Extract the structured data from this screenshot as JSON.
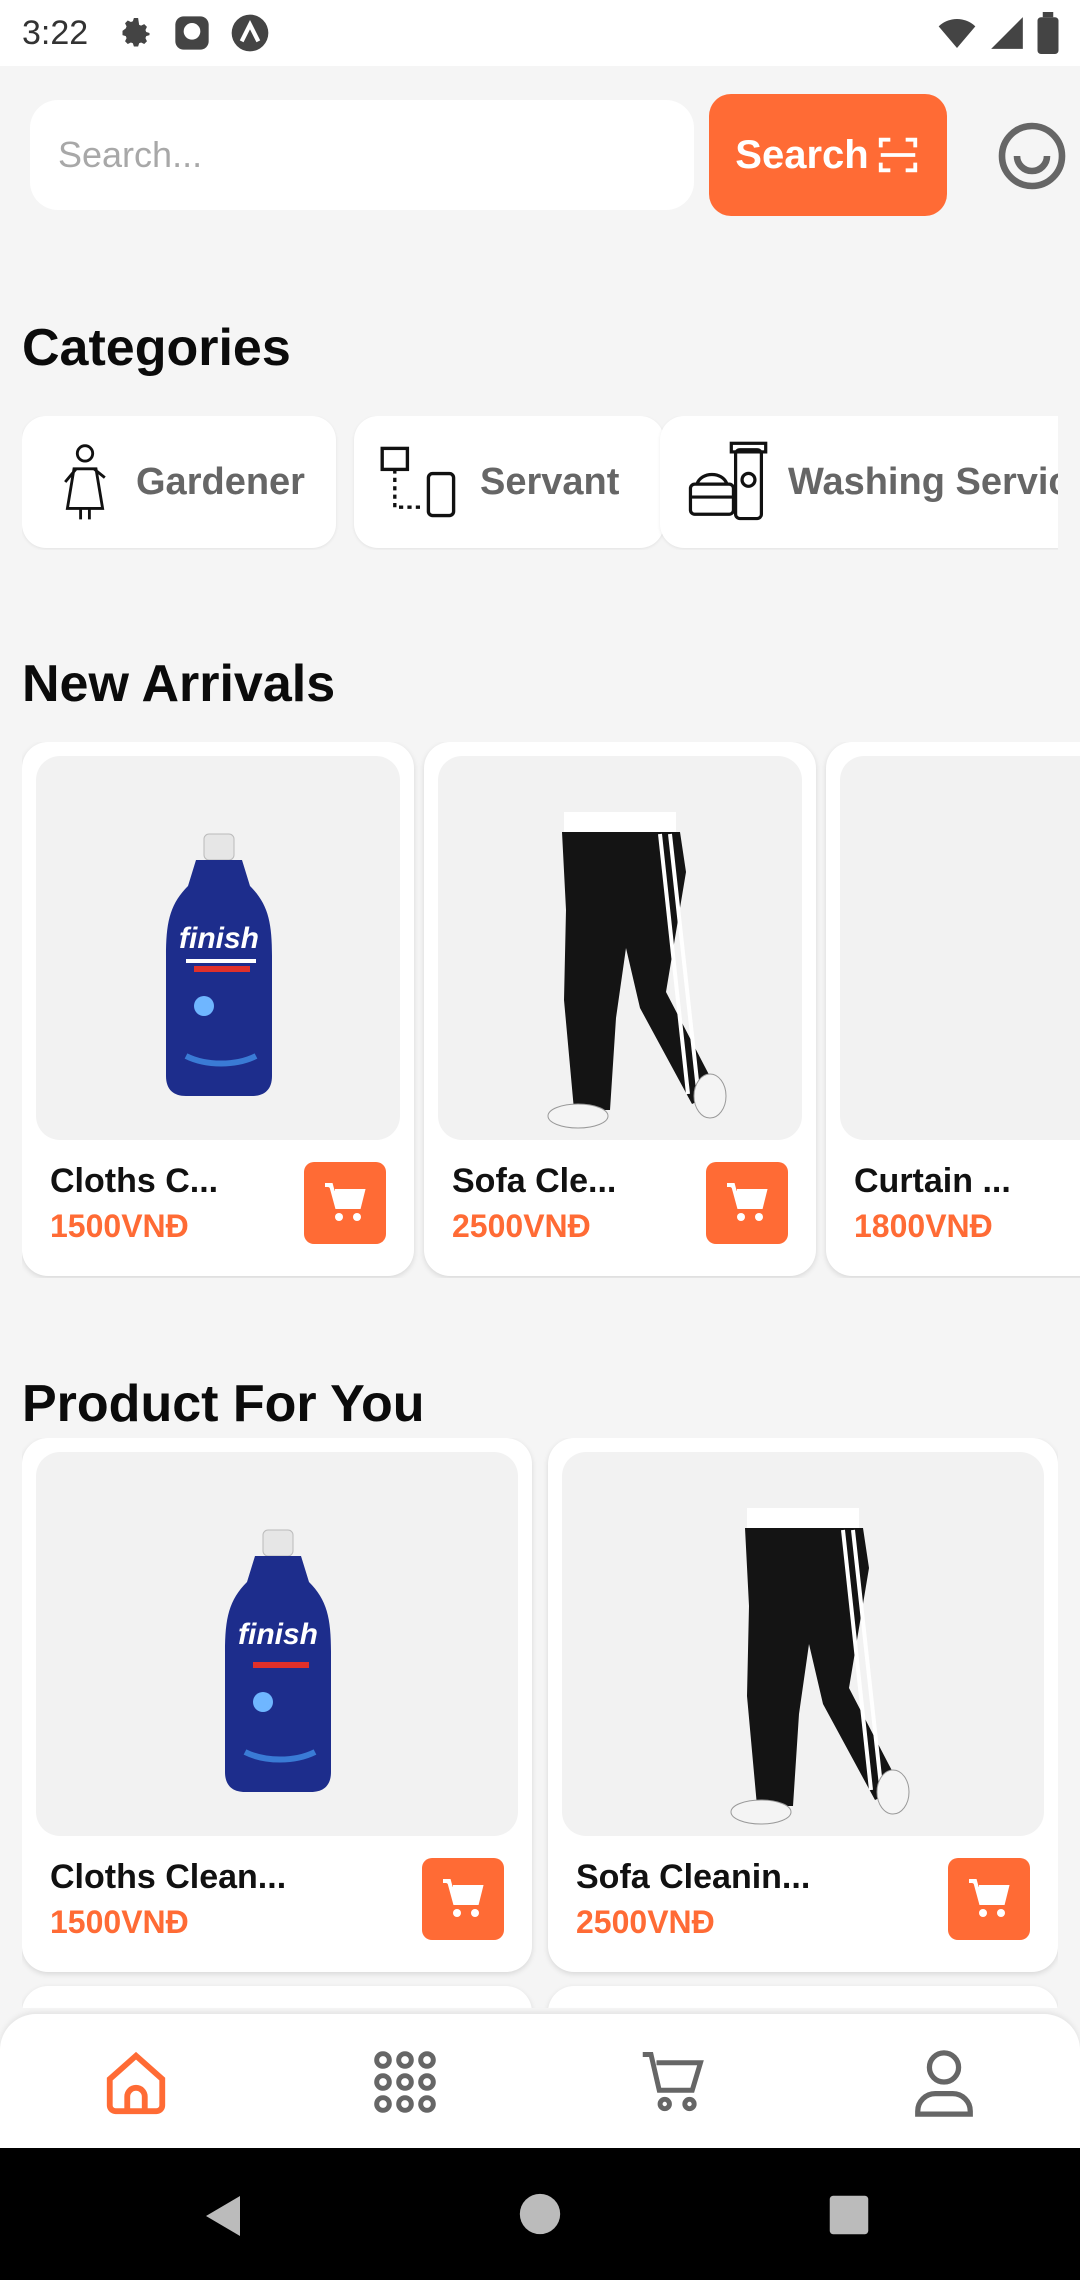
{
  "status": {
    "time": "3:22"
  },
  "search": {
    "placeholder": "Search...",
    "button_label": "Search"
  },
  "sections": {
    "categories": "Categories",
    "new_arrivals": "New Arrivals",
    "for_you": "Product For You"
  },
  "categories": [
    {
      "label": "Gardener",
      "icon": "gardener-icon"
    },
    {
      "label": "Servant",
      "icon": "devices-icon"
    },
    {
      "label": "Washing Servic",
      "icon": "washing-products-icon"
    }
  ],
  "new_arrivals": [
    {
      "name": "Cloths C...",
      "price": "1500VNĐ",
      "image": "rinse-aid-bottle"
    },
    {
      "name": "Sofa Cle...",
      "price": "2500VNĐ",
      "image": "black-track-pants"
    },
    {
      "name": "Curtain ...",
      "price": "1800VNĐ",
      "image": "blank"
    }
  ],
  "for_you": [
    {
      "name": "Cloths Clean...",
      "price": "1500VNĐ",
      "image": "rinse-aid-bottle"
    },
    {
      "name": "Sofa Cleanin...",
      "price": "2500VNĐ",
      "image": "black-track-pants"
    }
  ],
  "bottom_nav": [
    "home-icon",
    "grid-icon",
    "cart-icon",
    "profile-icon"
  ],
  "colors": {
    "accent": "#ff6b35",
    "background": "#f5f5f5"
  }
}
